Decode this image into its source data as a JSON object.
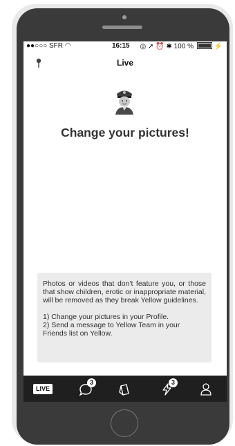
{
  "status_bar": {
    "carrier": "●●○○○ SFR",
    "time": "16:15",
    "battery_text": "100 %",
    "battery_level": 1.0
  },
  "header": {
    "title": "Live"
  },
  "main": {
    "headline": "Change your pictures!",
    "notice": {
      "paragraph": "Photos or videos that don't feature you, or those that show children, erotic or inappropriate material, will be removed as they break Yellow guidelines.",
      "steps": [
        "1) Change your pictures in your Profile.",
        "2) Send a message to Yellow Team in your Friends list on Yellow."
      ]
    }
  },
  "tab_bar": {
    "live_label": "LIVE",
    "chat_badge": "3",
    "notifications_badge": "3"
  }
}
